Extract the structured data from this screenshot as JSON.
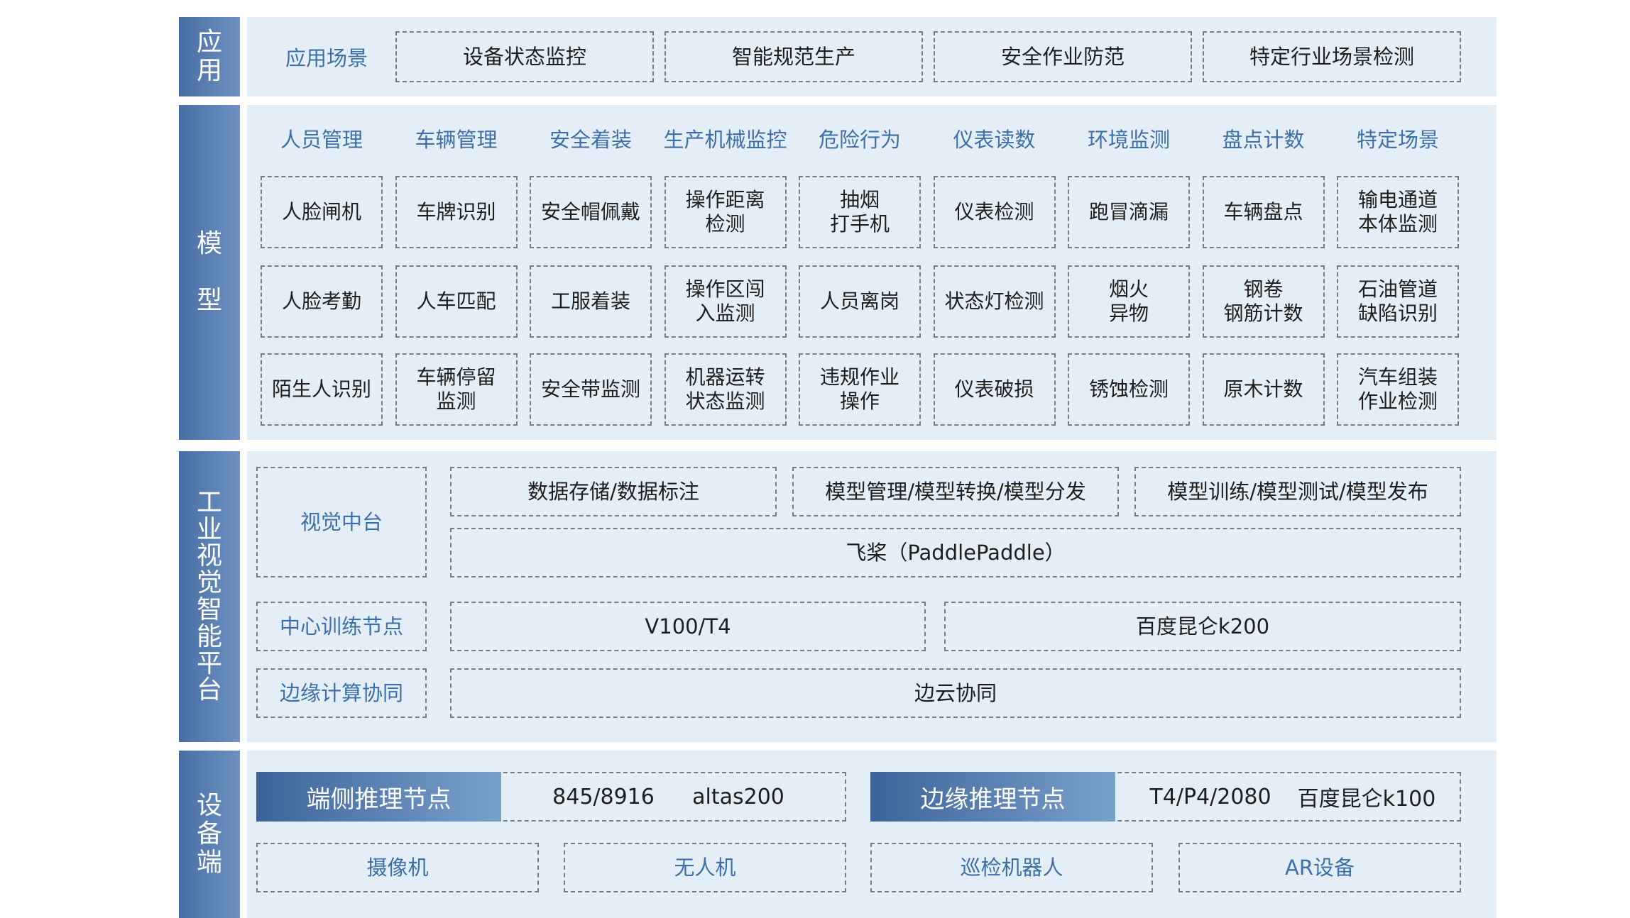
{
  "layers": {
    "app": "应\n用",
    "model": "模\n\n型",
    "platform": "工\n业\n视\n觉\n智\n能\n平\n台",
    "device": "设\n备\n端"
  },
  "app": {
    "label": "应用场景",
    "items": [
      "设备状态监控",
      "智能规范生产",
      "安全作业防范",
      "特定行业场景检测"
    ]
  },
  "model": {
    "categories": [
      "人员管理",
      "车辆管理",
      "安全着装",
      "生产机械监控",
      "危险行为",
      "仪表读数",
      "环境监测",
      "盘点计数",
      "特定场景"
    ],
    "rows": [
      [
        "人脸闸机",
        "车牌识别",
        "安全帽佩戴",
        "操作距离\n检测",
        "抽烟\n打手机",
        "仪表检测",
        "跑冒滴漏",
        "车辆盘点",
        "输电通道\n本体监测"
      ],
      [
        "人脸考勤",
        "人车匹配",
        "工服着装",
        "操作区闯\n入监测",
        "人员离岗",
        "状态灯检测",
        "烟火\n异物",
        "钢卷\n钢筋计数",
        "石油管道\n缺陷识别"
      ],
      [
        "陌生人识别",
        "车辆停留\n监测",
        "安全带监测",
        "机器运转\n状态监测",
        "违规作业\n操作",
        "仪表破损",
        "锈蚀检测",
        "原木计数",
        "汽车组装\n作业检测"
      ]
    ]
  },
  "platform": {
    "vision_center": "视觉中台",
    "data_storage": "数据存储/数据标注",
    "model_mgmt": "模型管理/模型转换/模型分发",
    "model_train": "模型训练/模型测试/模型发布",
    "paddle": "飞桨（PaddlePaddle）",
    "training_node": "中心训练节点",
    "v100": "V100/T4",
    "kunlun_k200": "百度昆仑k200",
    "edge_collab_label": "边缘计算协同",
    "edge_cloud": "边云协同"
  },
  "device": {
    "end_node": {
      "title": "端侧推理节点",
      "hw1": "845/8916",
      "hw2": "altas200"
    },
    "edge_node": {
      "title": "边缘推理节点",
      "hw1": "T4/P4/2080",
      "hw2": "百度昆仑k100"
    },
    "items": [
      "摄像机",
      "无人机",
      "巡检机器人",
      "AR设备"
    ]
  },
  "colors": {
    "side_dark": "#476da3",
    "side_light": "#6e93c2",
    "panel": "#e3eef6",
    "label_blue": "#3f6fa8",
    "border": "#6f7d8c"
  }
}
